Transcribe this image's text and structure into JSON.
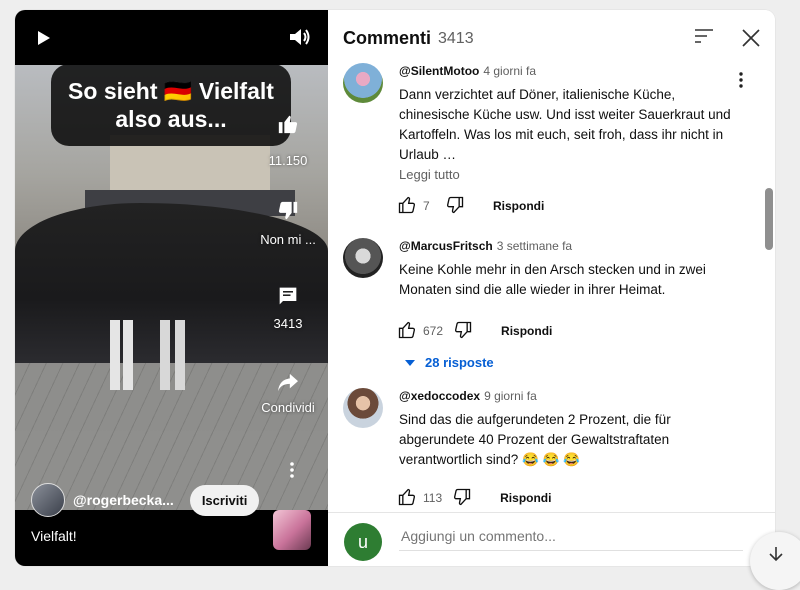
{
  "video": {
    "caption_line1": "So sieht 🇩🇪 Vielfalt",
    "caption_line2": "also aus...",
    "likes": "11.150",
    "dislike_label": "Non mi ...",
    "comments_count": "3413",
    "share_label": "Condividi",
    "channel": "@rogerbecka...",
    "subscribe_label": "Iscriviti",
    "title": "Vielfalt!"
  },
  "panel": {
    "title": "Commenti",
    "count": "3413",
    "add_placeholder": "Aggiungi un commento...",
    "user_initial": "u"
  },
  "comments": [
    {
      "author": "@SilentMotoo",
      "time": "4 giorni fa",
      "text": "Dann verzichtet auf Döner, italienische Küche, chinesische Küche usw. Und isst weiter Sauerkraut und Kartoffeln. Was los mit euch, seit froh, dass ihr nicht in Urlaub …",
      "read_more": "Leggi tutto",
      "likes": "7",
      "reply_label": "Rispondi"
    },
    {
      "author": "@MarcusFritsch",
      "time": "3 settimane fa",
      "text": "Keine Kohle mehr in den Arsch stecken und in zwei Monaten sind die alle wieder in ihrer Heimat.",
      "likes": "672",
      "reply_label": "Rispondi",
      "replies": "28 risposte"
    },
    {
      "author": "@xedoccodex",
      "time": "9 giorni fa",
      "text": "Sind das die aufgerundeten 2 Prozent, die für abgerundete 40 Prozent der Gewaltstraftaten verantwortlich sind? 😂 😂 😂",
      "likes": "113",
      "reply_label": "Rispondi"
    }
  ],
  "colors": {
    "link": "#065fd4",
    "text": "#0f0f0f",
    "muted": "#606060",
    "user_avatar": "#2e7d32"
  }
}
